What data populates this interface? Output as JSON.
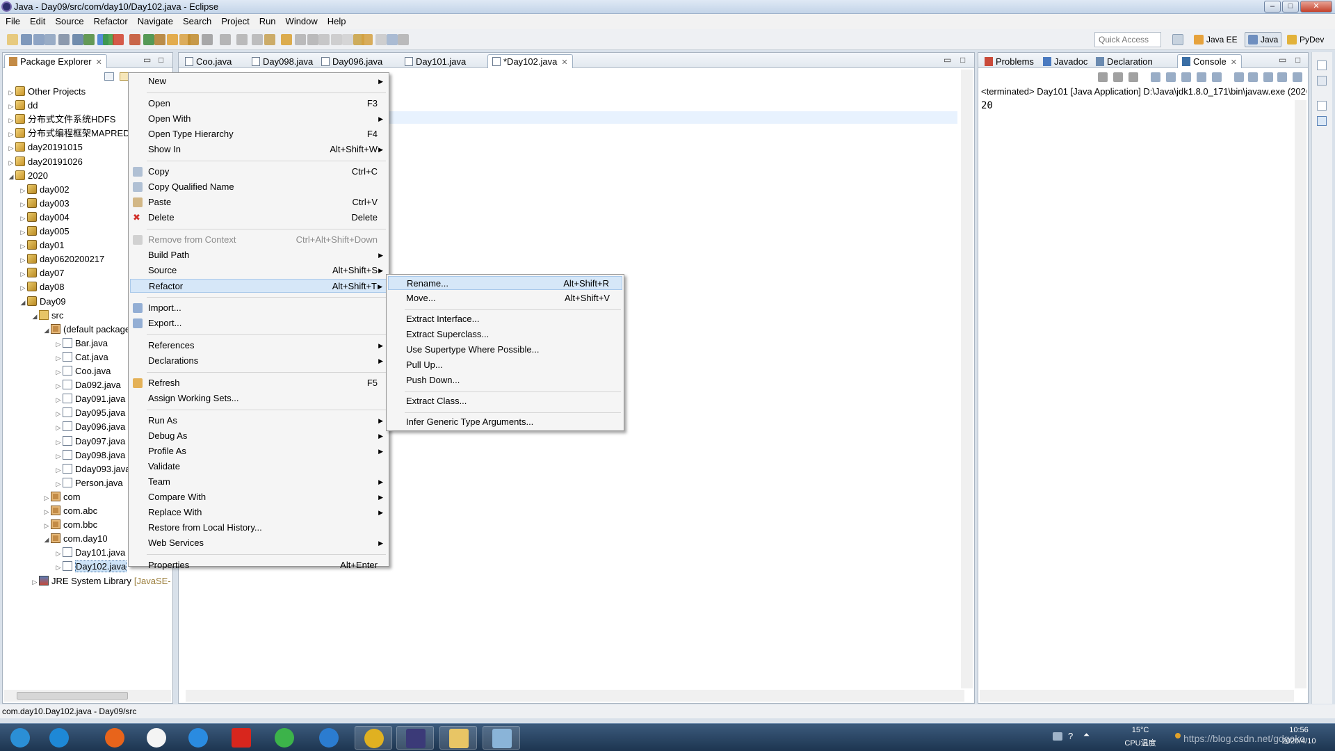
{
  "window": {
    "title": "Java - Day09/src/com/day10/Day102.java - Eclipse",
    "min": "–",
    "max": "□",
    "close": "✕"
  },
  "menubar": [
    "File",
    "Edit",
    "Source",
    "Refactor",
    "Navigate",
    "Search",
    "Project",
    "Run",
    "Window",
    "Help"
  ],
  "toolbar": {
    "quick_access_placeholder": "Quick Access",
    "perspectives": [
      "Java EE",
      "Java",
      "PyDev"
    ],
    "icon_colors": {
      "accent": "#3a6ea5"
    }
  },
  "package_explorer": {
    "title": "Package Explorer",
    "tree": [
      {
        "label": "Other Projects",
        "icon": "working-set-icon",
        "twisty": "▷"
      },
      {
        "label": "dd",
        "icon": "project-icon",
        "twisty": "▷"
      },
      {
        "label": "分布式文件系统HDFS",
        "icon": "project-icon",
        "twisty": "▷"
      },
      {
        "label": "分布式编程框架MAPRED",
        "icon": "project-icon",
        "twisty": "▷"
      },
      {
        "label": "day20191015",
        "icon": "project-icon",
        "twisty": "▷"
      },
      {
        "label": "day20191026",
        "icon": "project-icon",
        "twisty": "▷"
      },
      {
        "label": "2020",
        "icon": "working-set-icon",
        "twisty": "◢"
      },
      {
        "label": "day002",
        "icon": "java-project-icon",
        "twisty": "▷"
      },
      {
        "label": "day003",
        "icon": "java-project-icon",
        "twisty": "▷"
      },
      {
        "label": "day004",
        "icon": "java-project-icon",
        "twisty": "▷"
      },
      {
        "label": "day005",
        "icon": "java-project-icon",
        "twisty": "▷"
      },
      {
        "label": "day01",
        "icon": "java-project-icon",
        "twisty": "▷"
      },
      {
        "label": "day0620200217",
        "icon": "java-project-icon",
        "twisty": "▷"
      },
      {
        "label": "day07",
        "icon": "java-project-icon",
        "twisty": "▷"
      },
      {
        "label": "day08",
        "icon": "java-project-icon",
        "twisty": "▷"
      },
      {
        "label": "Day09",
        "icon": "java-project-icon",
        "twisty": "◢"
      },
      {
        "label": "src",
        "icon": "source-folder-icon",
        "twisty": "◢"
      },
      {
        "label": "(default package)",
        "icon": "package-icon",
        "twisty": "◢"
      },
      {
        "label": "Bar.java",
        "icon": "java-file-icon",
        "twisty": "▷"
      },
      {
        "label": "Cat.java",
        "icon": "java-file-icon",
        "twisty": "▷"
      },
      {
        "label": "Coo.java",
        "icon": "java-file-icon",
        "twisty": "▷"
      },
      {
        "label": "Da092.java",
        "icon": "java-file-icon",
        "twisty": "▷"
      },
      {
        "label": "Day091.java",
        "icon": "java-file-icon",
        "twisty": "▷"
      },
      {
        "label": "Day095.java",
        "icon": "java-file-icon",
        "twisty": "▷"
      },
      {
        "label": "Day096.java",
        "icon": "java-file-icon",
        "twisty": "▷"
      },
      {
        "label": "Day097.java",
        "icon": "java-file-icon",
        "twisty": "▷"
      },
      {
        "label": "Day098.java",
        "icon": "java-file-icon",
        "twisty": "▷"
      },
      {
        "label": "Dday093.java",
        "icon": "java-file-icon",
        "twisty": "▷"
      },
      {
        "label": "Person.java",
        "icon": "java-file-icon",
        "twisty": "▷"
      },
      {
        "label": "com",
        "icon": "package-icon",
        "twisty": "▷"
      },
      {
        "label": "com.abc",
        "icon": "package-icon",
        "twisty": "▷"
      },
      {
        "label": "com.bbc",
        "icon": "package-icon",
        "twisty": "▷"
      },
      {
        "label": "com.day10",
        "icon": "package-icon",
        "twisty": "◢"
      },
      {
        "label": "Day101.java",
        "icon": "java-file-icon",
        "twisty": "▷"
      },
      {
        "label": "Day102.java",
        "icon": "java-file-icon",
        "twisty": "▷",
        "selected": true
      },
      {
        "label": "JRE System Library",
        "suffix": "[JavaSE-",
        "icon": "library-icon",
        "twisty": "▷"
      }
    ]
  },
  "editor": {
    "tabs": [
      "Coo.java",
      "Day098.java",
      "Day096.java",
      "Day101.java",
      "*Day102.java"
    ],
    "active_tab": "*Day102.java"
  },
  "context_menu": {
    "items": [
      {
        "label": "New",
        "submenu": true
      },
      {
        "sep": true
      },
      {
        "label": "Open",
        "shortcut": "F3"
      },
      {
        "label": "Open With",
        "submenu": true
      },
      {
        "label": "Open Type Hierarchy",
        "shortcut": "F4"
      },
      {
        "label": "Show In",
        "shortcut": "Alt+Shift+W",
        "submenu": true
      },
      {
        "sep": true
      },
      {
        "label": "Copy",
        "shortcut": "Ctrl+C",
        "icon": "copy-icon"
      },
      {
        "label": "Copy Qualified Name",
        "icon": "copy-qualified-icon"
      },
      {
        "label": "Paste",
        "shortcut": "Ctrl+V",
        "icon": "paste-icon"
      },
      {
        "label": "Delete",
        "shortcut": "Delete",
        "icon": "delete-icon"
      },
      {
        "sep": true
      },
      {
        "label": "Remove from Context",
        "shortcut": "Ctrl+Alt+Shift+Down",
        "disabled": true,
        "icon": "remove-context-icon"
      },
      {
        "label": "Build Path",
        "submenu": true
      },
      {
        "label": "Source",
        "shortcut": "Alt+Shift+S",
        "submenu": true
      },
      {
        "label": "Refactor",
        "shortcut": "Alt+Shift+T",
        "submenu": true,
        "highlighted": true
      },
      {
        "sep": true
      },
      {
        "label": "Import...",
        "icon": "import-icon"
      },
      {
        "label": "Export...",
        "icon": "export-icon"
      },
      {
        "sep": true
      },
      {
        "label": "References",
        "submenu": true
      },
      {
        "label": "Declarations",
        "submenu": true
      },
      {
        "sep": true
      },
      {
        "label": "Refresh",
        "shortcut": "F5",
        "icon": "refresh-icon"
      },
      {
        "label": "Assign Working Sets..."
      },
      {
        "sep": true
      },
      {
        "label": "Run As",
        "submenu": true
      },
      {
        "label": "Debug As",
        "submenu": true
      },
      {
        "label": "Profile As",
        "submenu": true
      },
      {
        "label": "Validate"
      },
      {
        "label": "Team",
        "submenu": true
      },
      {
        "label": "Compare With",
        "submenu": true
      },
      {
        "label": "Replace With",
        "submenu": true
      },
      {
        "label": "Restore from Local History..."
      },
      {
        "label": "Web Services",
        "submenu": true
      },
      {
        "sep": true
      },
      {
        "label": "Properties",
        "shortcut": "Alt+Enter"
      }
    ]
  },
  "refactor_submenu": {
    "items": [
      {
        "label": "Rename...",
        "shortcut": "Alt+Shift+R",
        "highlighted": true
      },
      {
        "label": "Move...",
        "shortcut": "Alt+Shift+V"
      },
      {
        "sep": true
      },
      {
        "label": "Extract Interface..."
      },
      {
        "label": "Extract Superclass..."
      },
      {
        "label": "Use Supertype Where Possible..."
      },
      {
        "label": "Pull Up..."
      },
      {
        "label": "Push Down..."
      },
      {
        "sep": true
      },
      {
        "label": "Extract Class..."
      },
      {
        "sep": true
      },
      {
        "label": "Infer Generic Type Arguments..."
      }
    ]
  },
  "console_panel": {
    "tabs": [
      "Problems",
      "Javadoc",
      "Declaration",
      "Console"
    ],
    "active_tab": "Console",
    "header": "<terminated> Day101 [Java Application] D:\\Java\\jdk1.8.0_171\\bin\\javaw.exe (2020",
    "output": "20"
  },
  "statusbar": {
    "text": "com.day10.Day102.java - Day09/src"
  },
  "taskbar": {
    "apps": [
      {
        "name": "start-button",
        "color": "#2b8fd6"
      },
      {
        "name": "ie-icon",
        "color": "#1e88d6"
      },
      {
        "name": "firefox-icon",
        "color": "#e8641b"
      },
      {
        "name": "photos-icon",
        "color": "#f4f4f4"
      },
      {
        "name": "cloud-icon",
        "color": "#2a8be0"
      },
      {
        "name": "youdao-icon",
        "color": "#d8261d"
      },
      {
        "name": "browser360-icon",
        "color": "#3cb34a"
      },
      {
        "name": "ie2-icon",
        "color": "#2b7cd0"
      },
      {
        "name": "chrome-icon",
        "color": "#e0b121"
      },
      {
        "name": "eclipse-icon",
        "color": "#3b3a78"
      },
      {
        "name": "explorer-icon",
        "color": "#e8c565"
      },
      {
        "name": "notepad-icon",
        "color": "#8ab4d8"
      }
    ],
    "weather": "15°C",
    "cpu": "CPU温度",
    "time": "10:56",
    "date": "2020/4/10",
    "watermark": "https://blog.csdn.net/gdgoko"
  }
}
